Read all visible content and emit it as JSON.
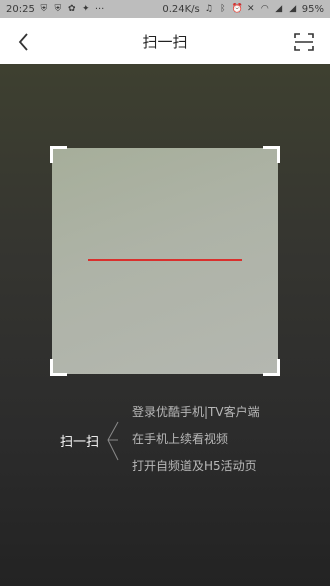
{
  "status_bar": {
    "time": "20:25",
    "dots": "···",
    "network_speed": "0.24K/s",
    "battery": "95%"
  },
  "nav": {
    "title": "扫一扫"
  },
  "scanner": {
    "accent_color": "#d9302d"
  },
  "hints": {
    "label": "扫一扫",
    "items": [
      "登录优酷手机|TV客户端",
      "在手机上续看视频",
      "打开自频道及H5活动页"
    ]
  }
}
